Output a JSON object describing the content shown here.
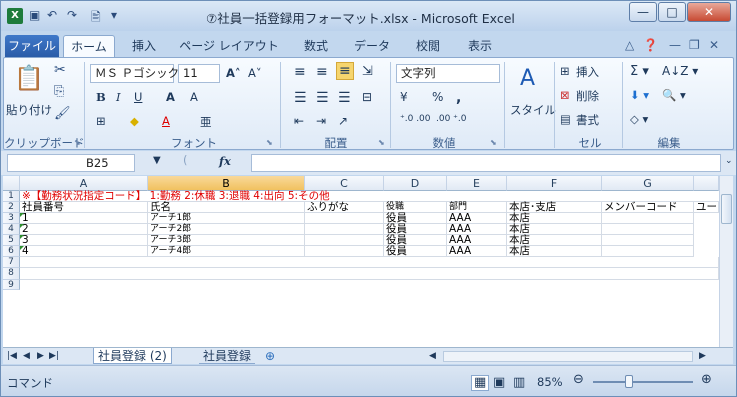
{
  "window": {
    "title": "⑦社員一括登録用フォーマット.xlsx - Microsoft Excel",
    "minimize_glyph": "—",
    "maximize_glyph": "□",
    "close_glyph": "✕"
  },
  "quick_access": {
    "app_icon": "X",
    "save_icon": "save-icon",
    "undo_icon": "undo-icon",
    "redo_icon": "redo-icon"
  },
  "ribbon_tabs": [
    "ファイル",
    "ホーム",
    "挿入",
    "ページ レイアウト",
    "数式",
    "データ",
    "校閲",
    "表示"
  ],
  "ribbon": {
    "clipboard": {
      "paste": "貼り付け",
      "label": "クリップボード"
    },
    "font": {
      "name": "ＭＳ Ｐゴシック",
      "size": "11",
      "label": "フォント"
    },
    "alignment": {
      "label": "配置"
    },
    "number": {
      "format": "文字列",
      "label": "数値",
      "percent": "%",
      "comma": ","
    },
    "styles": {
      "button": "スタイル"
    },
    "cells": {
      "insert": "挿入",
      "delete": "削除",
      "format": "書式",
      "label": "セル"
    },
    "editing": {
      "label": "編集"
    }
  },
  "formula_bar": {
    "name_box": "B25",
    "fx": "fx",
    "formula": ""
  },
  "columns": [
    "A",
    "B",
    "C",
    "D",
    "E",
    "F",
    "G"
  ],
  "rows": [
    "1",
    "2",
    "3",
    "4",
    "5",
    "6",
    "7",
    "8",
    "9"
  ],
  "cells": {
    "r1": "※【勤務状況指定コード】 1:勤務  2:休職  3:退職  4:出向  5:その他",
    "r2": [
      "社員番号",
      "氏名",
      "ふりがな",
      "役職",
      "部門",
      "本店･支店",
      "メンバーコード",
      "ユー"
    ],
    "data": [
      [
        "1",
        "アーチ1郎",
        "",
        "役員",
        "AAA",
        "本店"
      ],
      [
        "2",
        "アーチ2郎",
        "",
        "役員",
        "AAA",
        "本店"
      ],
      [
        "3",
        "アーチ3郎",
        "",
        "役員",
        "AAA",
        "本店"
      ],
      [
        "4",
        "アーチ4郎",
        "",
        "役員",
        "AAA",
        "本店"
      ]
    ]
  },
  "sheets": [
    "社員登録 (2)",
    "社員登録"
  ],
  "status": {
    "mode": "コマンド",
    "zoom": "85%"
  }
}
